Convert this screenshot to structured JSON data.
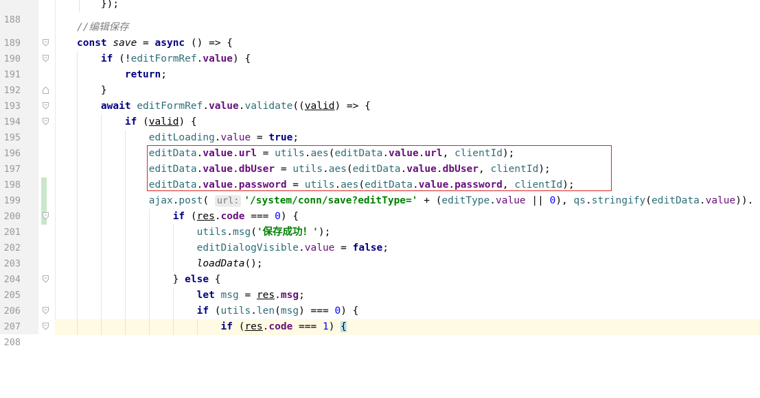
{
  "editor": {
    "lines": [
      {
        "num": "188",
        "text": "    });"
      },
      {
        "num": "189",
        "text": "    //编辑保存"
      },
      {
        "num": "190",
        "text": "    const save = async () => {"
      },
      {
        "num": "191",
        "text": "        if (!editFormRef.value) {"
      },
      {
        "num": "192",
        "text": "            return;"
      },
      {
        "num": "193",
        "text": "        }"
      },
      {
        "num": "194",
        "text": "        await editFormRef.value.validate((valid) => {"
      },
      {
        "num": "195",
        "text": "            if (valid) {"
      },
      {
        "num": "196",
        "text": "                editLoading.value = true;"
      },
      {
        "num": "197",
        "text": "                editData.value.url = utils.aes(editData.value.url, clientId);"
      },
      {
        "num": "198",
        "text": "                editData.value.dbUser = utils.aes(editData.value.dbUser, clientId);"
      },
      {
        "num": "199",
        "text": "                editData.value.password = utils.aes(editData.value.password, clientId);"
      },
      {
        "num": "200",
        "text": "                ajax.post( url: '/system/conn/save?editType=' + (editType.value || 0), qs.stringify(editData.value))."
      },
      {
        "num": "201",
        "text": "                    if (res.code === 0) {"
      },
      {
        "num": "202",
        "text": "                        utils.msg('保存成功！');"
      },
      {
        "num": "203",
        "text": "                        editDialogVisible.value = false;"
      },
      {
        "num": "204",
        "text": "                        loadData();"
      },
      {
        "num": "205",
        "text": "                    } else {"
      },
      {
        "num": "206",
        "text": "                        let msg = res.msg;"
      },
      {
        "num": "207",
        "text": "                        if (utils.len(msg) === 0) {"
      },
      {
        "num": "208",
        "text": "                            if (res.code === 1) {"
      }
    ],
    "modified_lines": [
      "197",
      "198",
      "199"
    ],
    "current_line": "208",
    "param_hint": "url:",
    "highlight_color": "#d9231f"
  }
}
